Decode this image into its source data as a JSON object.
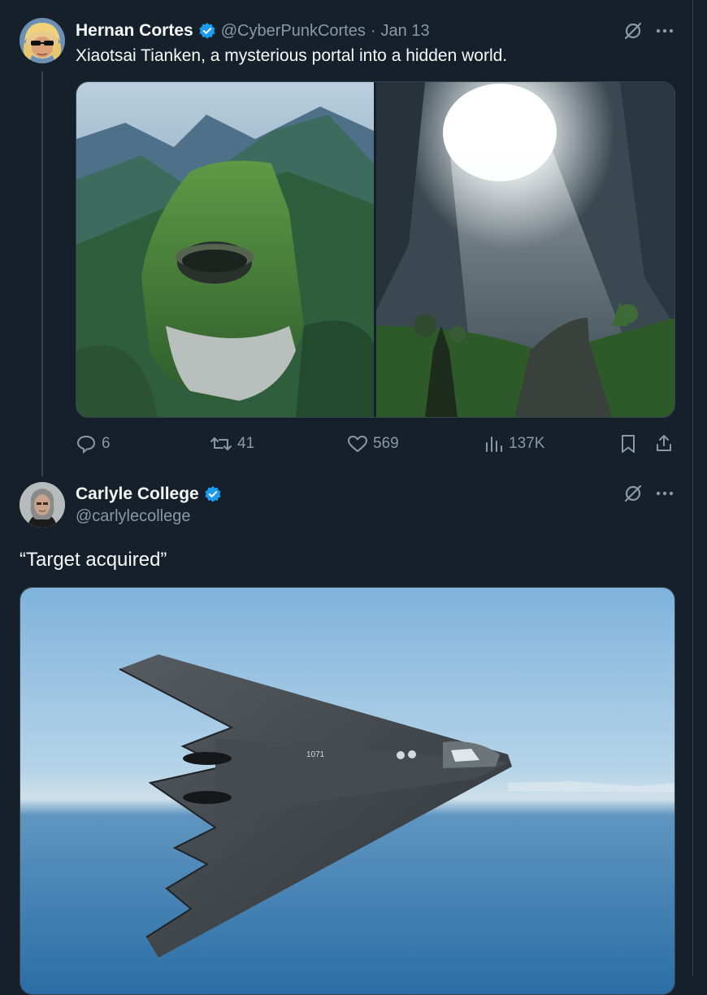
{
  "tweet1": {
    "author_name": "Hernan Cortes",
    "handle": "@CyberPunkCortes",
    "separator": "·",
    "date": "Jan 13",
    "text": "Xiaotsai Tianken, a mysterious portal into a hidden world.",
    "stats": {
      "replies": "6",
      "retweets": "41",
      "likes": "569",
      "views": "137K"
    }
  },
  "tweet2": {
    "author_name": "Carlyle College",
    "handle": "@carlylecollege",
    "text": "“Target acquired”",
    "plane_marking": "1071"
  },
  "icons": {
    "verified": "verified-badge-icon",
    "grok": "grok-icon",
    "more": "more-icon",
    "reply": "reply-icon",
    "retweet": "retweet-icon",
    "like": "like-icon",
    "views": "views-icon",
    "bookmark": "bookmark-icon",
    "share": "share-icon"
  },
  "colors": {
    "background": "#15202b",
    "border": "#38444d",
    "muted": "#8b98a5",
    "text": "#f7f9f9",
    "verified": "#1d9bf0"
  }
}
